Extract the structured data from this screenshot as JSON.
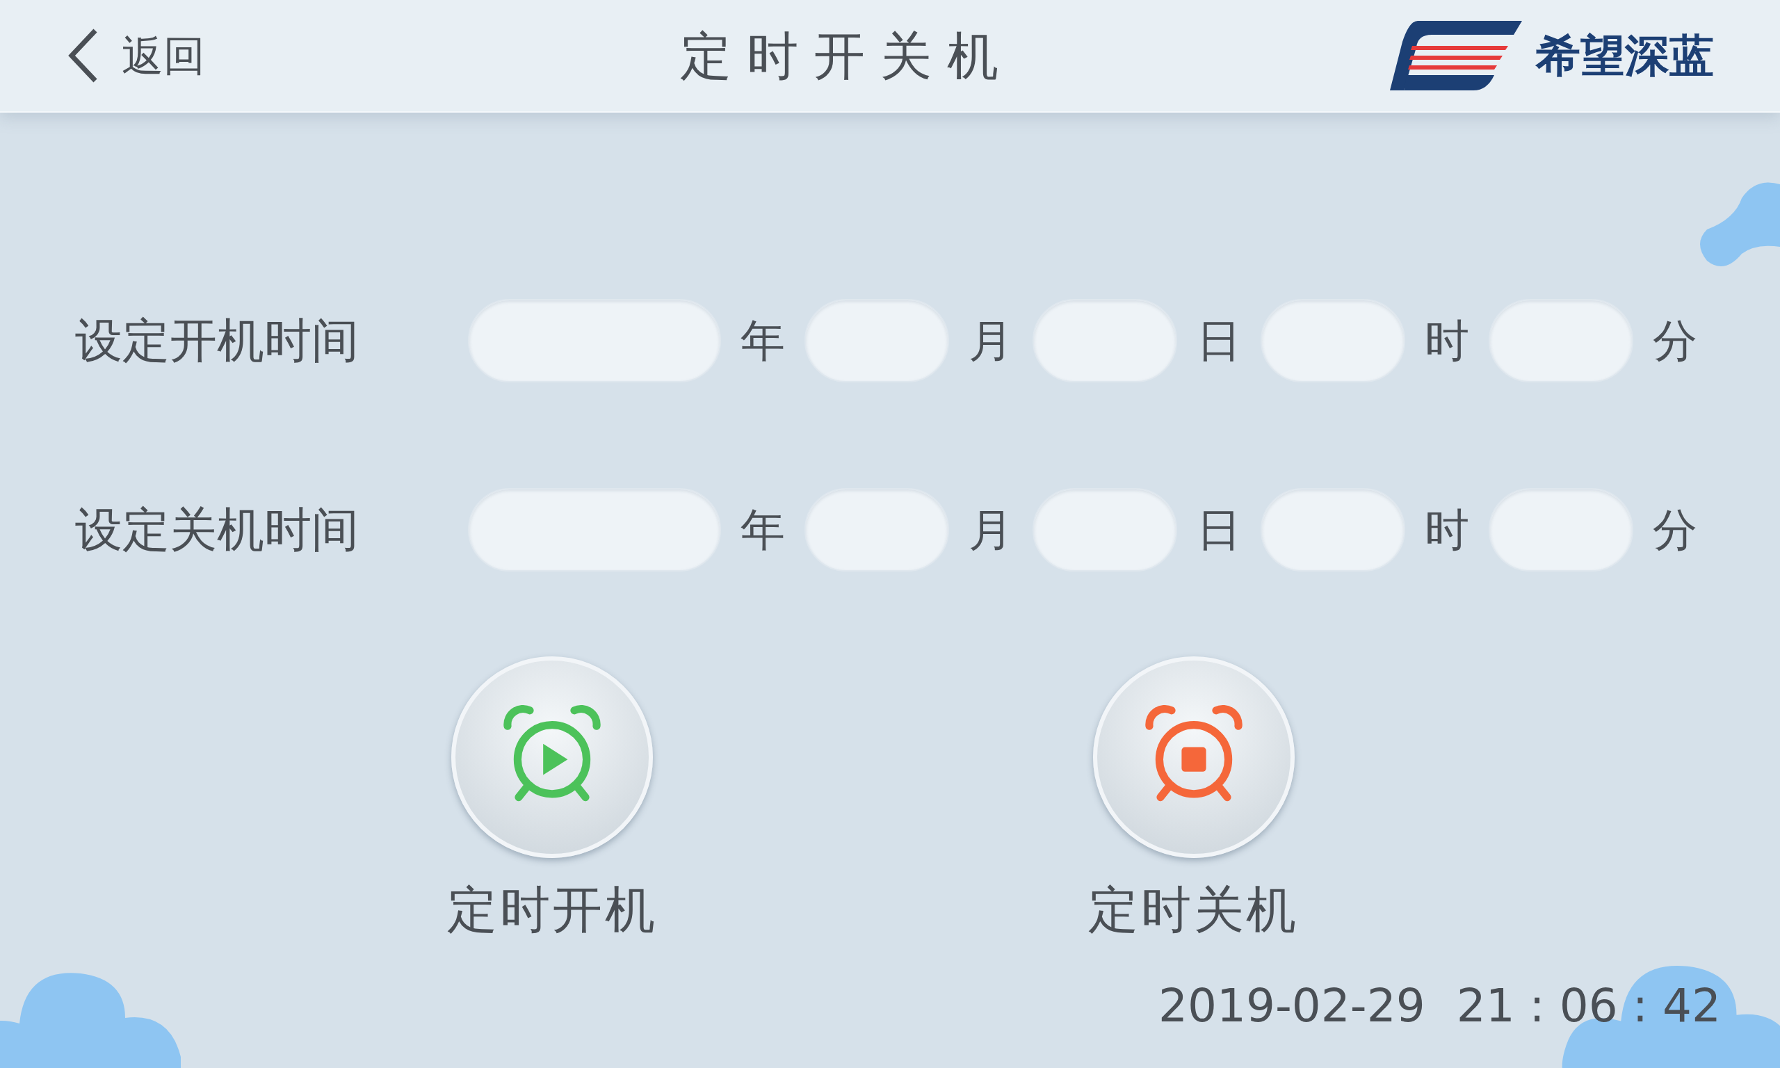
{
  "header": {
    "back_label": "返回",
    "title": "定时开关机",
    "logo_text": "希望深蓝"
  },
  "rows": [
    {
      "label": "设定开机时间",
      "fields": [
        {
          "unit": "年"
        },
        {
          "unit": "月"
        },
        {
          "unit": "日"
        },
        {
          "unit": "时"
        },
        {
          "unit": "分"
        }
      ]
    },
    {
      "label": "设定关机时间",
      "fields": [
        {
          "unit": "年"
        },
        {
          "unit": "月"
        },
        {
          "unit": "日"
        },
        {
          "unit": "时"
        },
        {
          "unit": "分"
        }
      ]
    }
  ],
  "buttons": [
    {
      "kind": "start",
      "label": "定时开机"
    },
    {
      "kind": "stop",
      "label": "定时关机"
    }
  ],
  "status": {
    "date": "2019-02-29",
    "time": "21 : 06 : 42"
  }
}
